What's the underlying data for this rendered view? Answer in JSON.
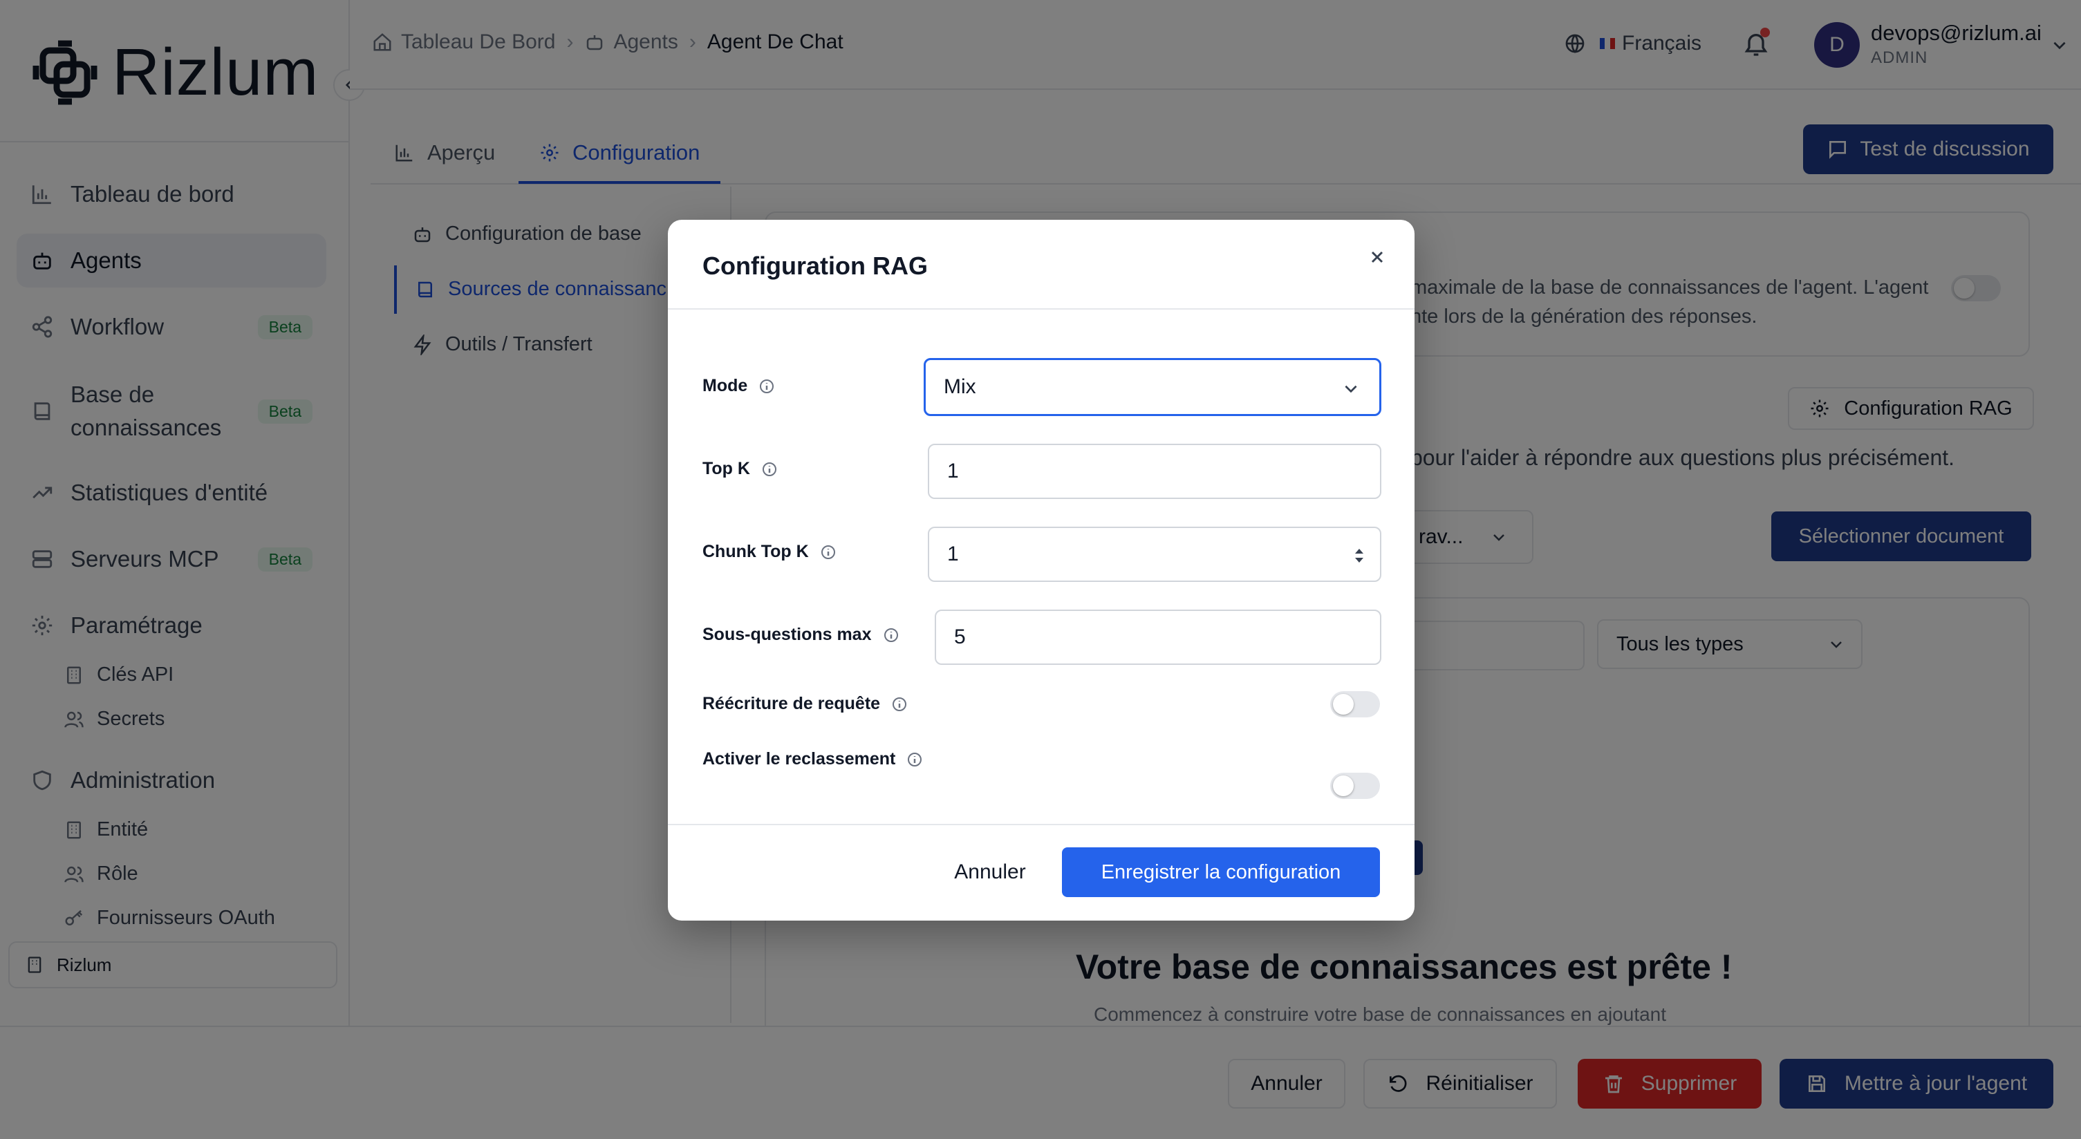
{
  "app": {
    "brand": "Rizlum"
  },
  "sidebar": {
    "items": [
      {
        "label": "Tableau de bord",
        "icon": "bar-chart-icon"
      },
      {
        "label": "Agents",
        "icon": "bot-icon",
        "active": true
      },
      {
        "label": "Workflow",
        "icon": "share-nodes-icon",
        "badge": "Beta"
      },
      {
        "label": "Base de connaissances",
        "label_line1": "Base de",
        "label_line2": "connaissances",
        "icon": "book-icon",
        "badge": "Beta"
      },
      {
        "label": "Statistiques d'entité",
        "icon": "trending-up-icon"
      },
      {
        "label": "Serveurs MCP",
        "icon": "server-icon",
        "badge": "Beta"
      },
      {
        "label": "Paramétrage",
        "icon": "gear-icon"
      },
      {
        "label": "Administration",
        "icon": "shield-icon"
      }
    ],
    "settings_sub": [
      {
        "label": "Clés API",
        "icon": "building-icon"
      },
      {
        "label": "Secrets",
        "icon": "users-icon"
      }
    ],
    "admin_sub": [
      {
        "label": "Entité",
        "icon": "building-icon"
      },
      {
        "label": "Rôle",
        "icon": "users-icon"
      },
      {
        "label": "Fournisseurs OAuth",
        "icon": "key-icon"
      }
    ],
    "org": "Rizlum"
  },
  "header": {
    "breadcrumb": [
      "Tableau De Bord",
      "Agents",
      "Agent De Chat"
    ],
    "language": "Français",
    "user_email": "devops@rizlum.ai",
    "user_role": "ADMIN",
    "avatar_letter": "D"
  },
  "tabs": [
    {
      "label": "Aperçu",
      "icon": "bar-chart-icon"
    },
    {
      "label": "Configuration",
      "icon": "gear-icon",
      "active": true
    }
  ],
  "test_button": "Test de discussion",
  "config_nav": [
    {
      "label": "Configuration de base",
      "icon": "bot-icon"
    },
    {
      "label": "Sources de connaissanc",
      "icon": "book-icon",
      "active": true
    },
    {
      "label": "Outils / Transfert",
      "icon": "zap-icon"
    }
  ],
  "background": {
    "desc_line1": "maximale de la base de connaissances de l'agent. L'agent",
    "desc_line2": "nte lors de la génération des réponses.",
    "rag_button": "Configuration RAG",
    "help_text": "pour l'aider à répondre aux questions plus précisément.",
    "dropdown_partial": "rav...",
    "select_doc_button": "Sélectionner document",
    "type_filter": "Tous les types",
    "empty_title": "Votre base de connaissances est prête !",
    "empty_sub": "Commencez à construire votre base de connaissances en ajoutant"
  },
  "footer": {
    "cancel": "Annuler",
    "reset": "Réinitialiser",
    "delete": "Supprimer",
    "update": "Mettre à jour l'agent"
  },
  "modal": {
    "title": "Configuration RAG",
    "mode_label": "Mode",
    "mode_value": "Mix",
    "top_k_label": "Top K",
    "top_k_value": "1",
    "chunk_top_k_label": "Chunk Top K",
    "chunk_top_k_value": "1",
    "max_subq_label": "Sous-questions max",
    "max_subq_value": "5",
    "rewrite_label": "Réécriture de requête",
    "rewrite_enabled": false,
    "rerank_label": "Activer le reclassement",
    "rerank_enabled": false,
    "cancel": "Annuler",
    "save": "Enregistrer la configuration"
  },
  "colors": {
    "primary": "#2563eb",
    "navy": "#1e3a8a",
    "danger": "#dc2626",
    "beta_bg": "#e7f7ec",
    "beta_text": "#15803d"
  }
}
